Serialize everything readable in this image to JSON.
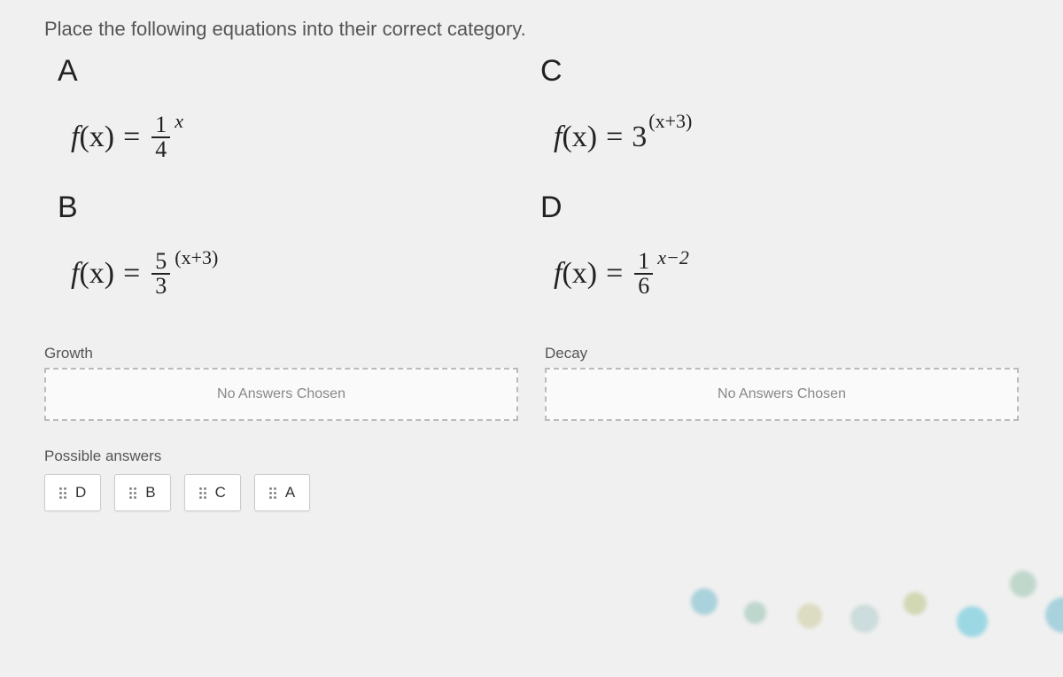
{
  "instruction": "Place the following equations into their correct category.",
  "equations": {
    "a": {
      "label": "A"
    },
    "b": {
      "label": "B"
    },
    "c": {
      "label": "C"
    },
    "d": {
      "label": "D"
    }
  },
  "equation_text": {
    "fx": "f",
    "open": "(x)",
    "equals": "=",
    "frac_1_4": {
      "num": "1",
      "den": "4"
    },
    "frac_5_3": {
      "num": "5",
      "den": "3"
    },
    "frac_1_6": {
      "num": "1",
      "den": "6"
    },
    "exp_x": "x",
    "exp_xp3": "(x+3)",
    "exp_xm2": "x−2",
    "base3": "3"
  },
  "dropzones": {
    "growth": {
      "label": "Growth",
      "placeholder": "No Answers Chosen"
    },
    "decay": {
      "label": "Decay",
      "placeholder": "No Answers Chosen"
    }
  },
  "possible": {
    "label": "Possible answers",
    "chips": [
      "D",
      "B",
      "C",
      "A"
    ]
  }
}
